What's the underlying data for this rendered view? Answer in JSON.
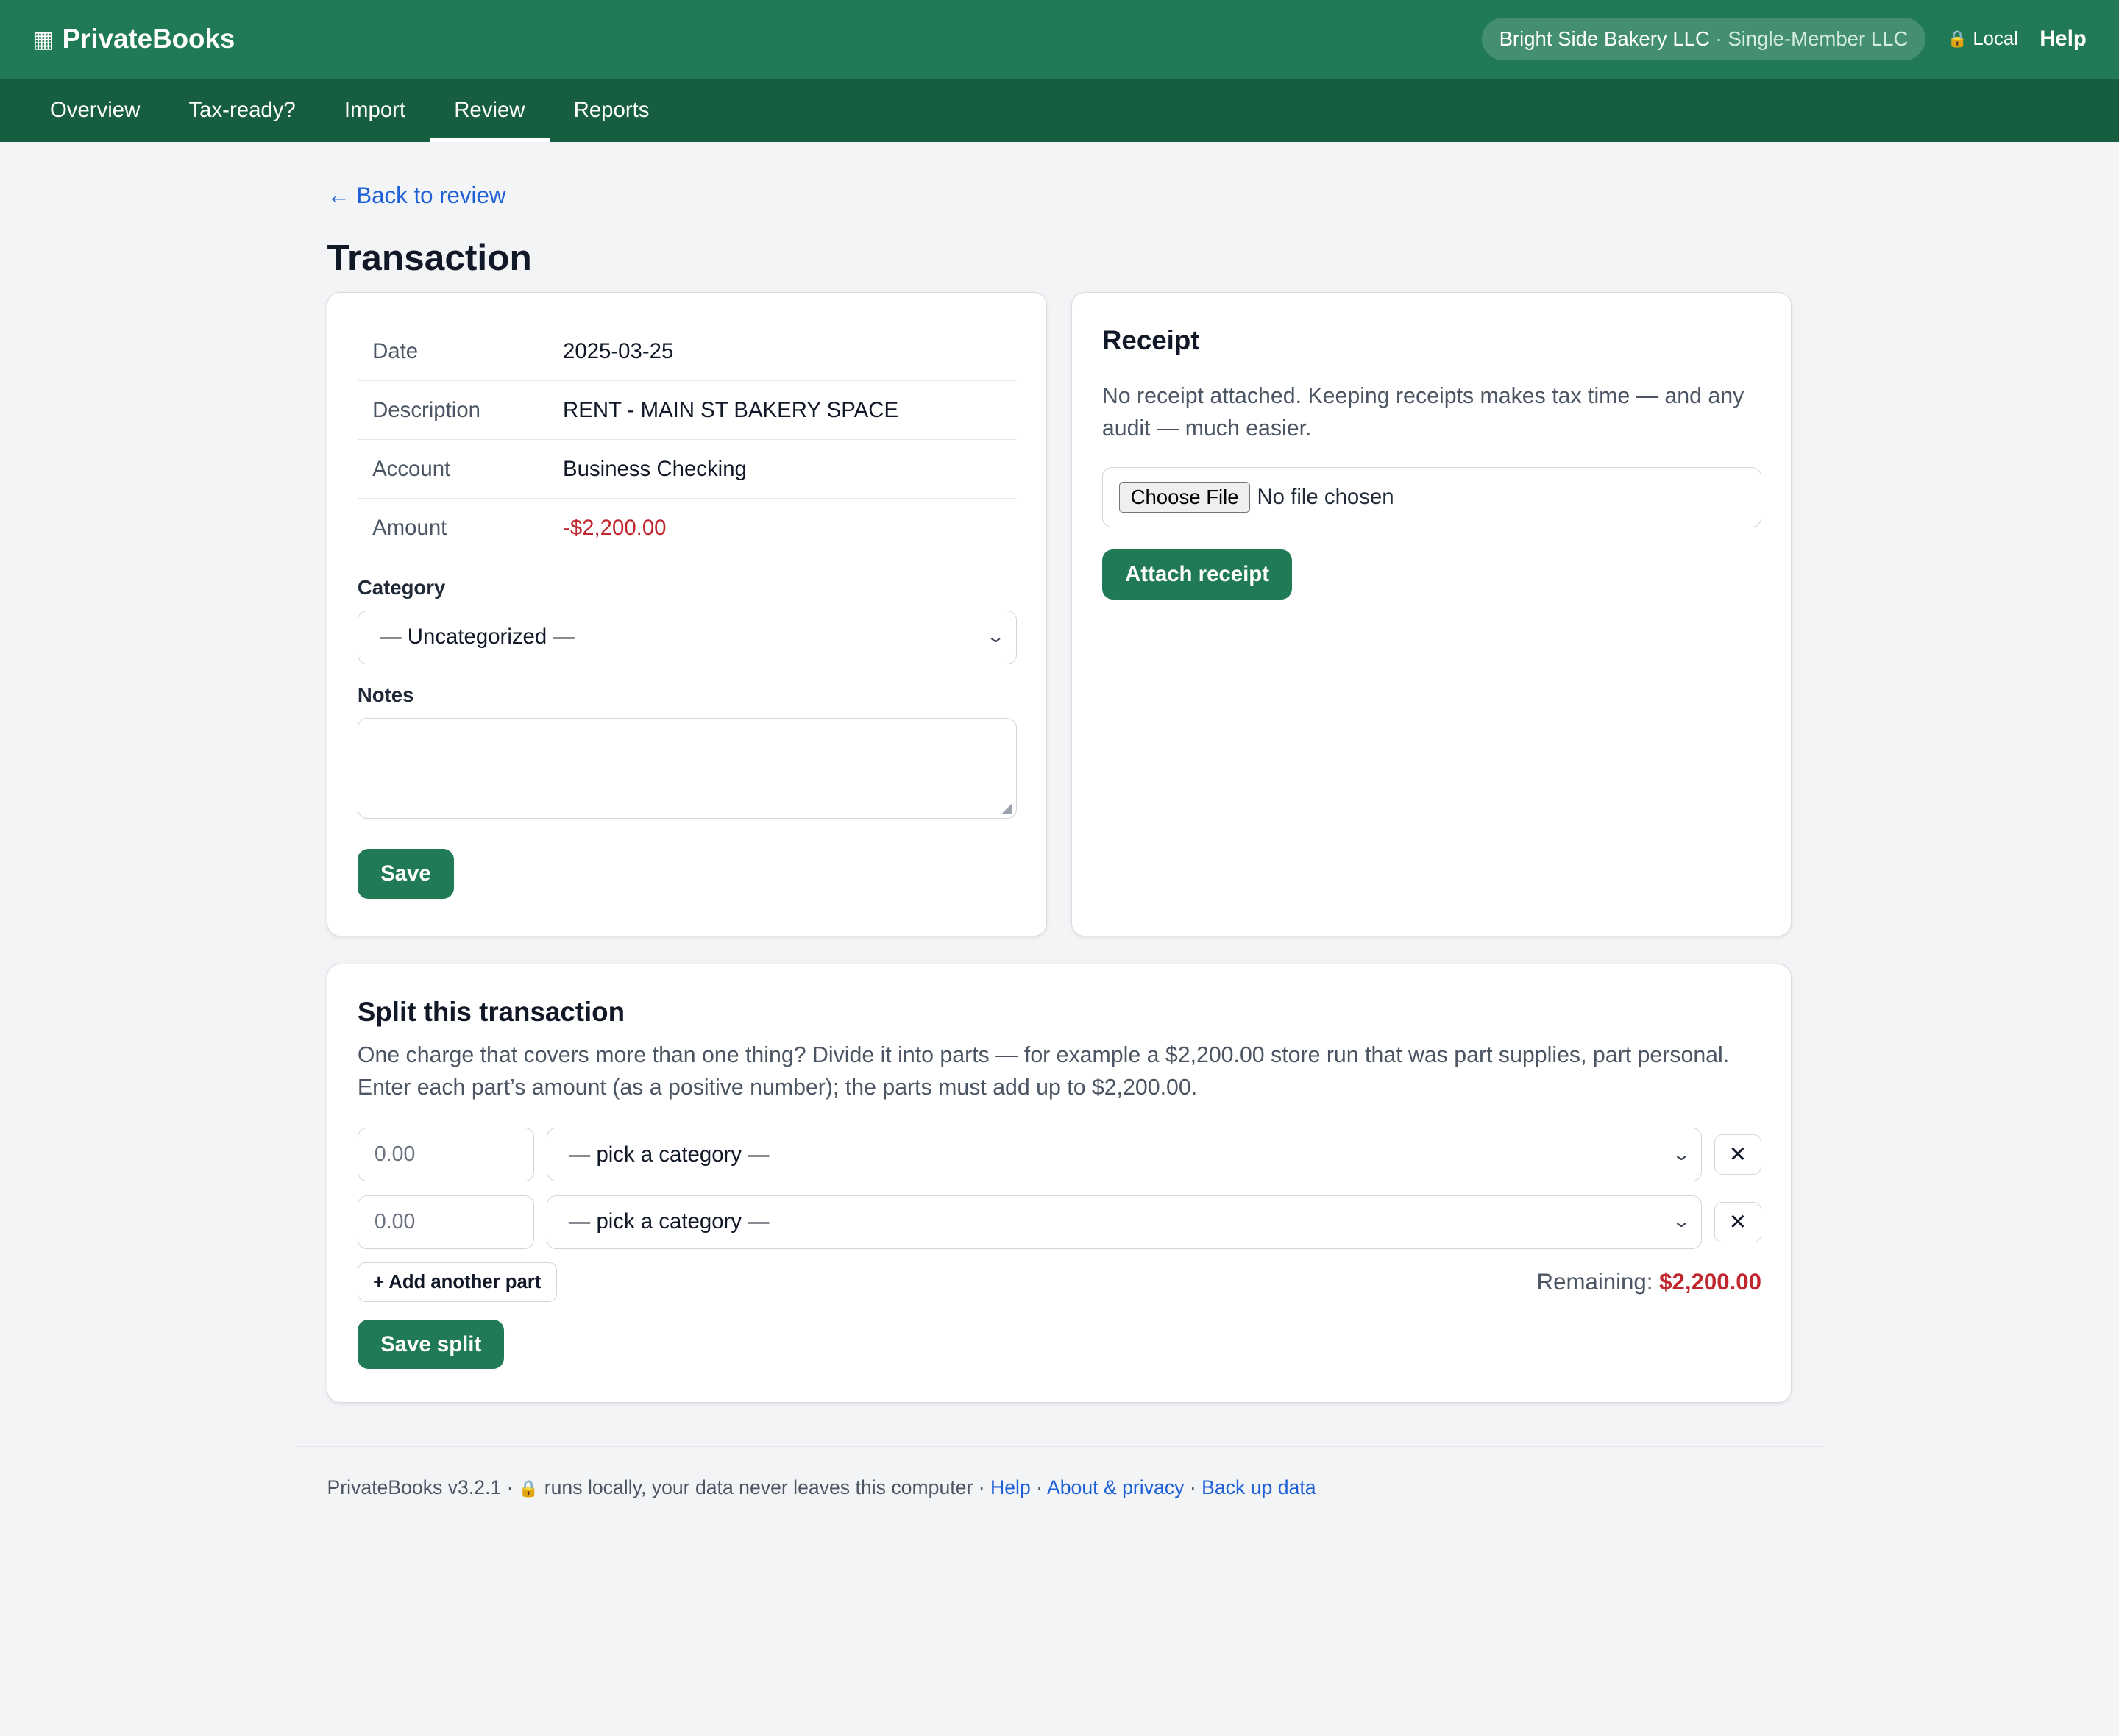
{
  "header": {
    "brand_icon": "▦",
    "brand": "PrivateBooks",
    "business_name": "Bright Side Bakery LLC",
    "business_type": " · Single-Member LLC",
    "lock_icon": "🔒",
    "local_label": "Local",
    "help_label": "Help"
  },
  "nav": {
    "tabs": [
      {
        "label": "Overview",
        "active": false
      },
      {
        "label": "Tax-ready?",
        "active": false
      },
      {
        "label": "Import",
        "active": false
      },
      {
        "label": "Review",
        "active": true
      },
      {
        "label": "Reports",
        "active": false
      }
    ]
  },
  "page": {
    "back_link": "← Back to review",
    "title": "Transaction"
  },
  "details": {
    "date_label": "Date",
    "date_value": "2025-03-25",
    "description_label": "Description",
    "description_value": "RENT - MAIN ST BAKERY SPACE",
    "account_label": "Account",
    "account_value": "Business Checking",
    "amount_label": "Amount",
    "amount_value": "-$2,200.00",
    "category_label": "Category",
    "category_value": "— Uncategorized —",
    "notes_label": "Notes",
    "notes_value": "",
    "save_label": "Save"
  },
  "receipt": {
    "title": "Receipt",
    "message": "No receipt attached. Keeping receipts makes tax time — and any audit — much easier.",
    "choose_file_label": "Choose File",
    "no_file_label": "No file chosen",
    "attach_label": "Attach receipt"
  },
  "split": {
    "title": "Split this transaction",
    "description": "One charge that covers more than one thing? Divide it into parts — for example a $2,200.00 store run that was part supplies, part personal. Enter each part’s amount (as a positive number); the parts must add up to $2,200.00.",
    "parts": [
      {
        "amount_placeholder": "0.00",
        "category": "— pick a category —"
      },
      {
        "amount_placeholder": "0.00",
        "category": "— pick a category —"
      }
    ],
    "remove_glyph": "✕",
    "add_label": "+ Add another part",
    "remaining_label": "Remaining: ",
    "remaining_value": "$2,200.00",
    "save_label": "Save split"
  },
  "footer": {
    "version": "PrivateBooks v3.2.1 · ",
    "lock_icon": "🔒",
    "local_note": " runs locally, your data never leaves this computer · ",
    "help_link": "Help",
    "about_link": "About & privacy",
    "backup_link": "Back up data",
    "sep": " · "
  },
  "colors": {
    "brand_green": "#1f7a55",
    "nav_green": "#175e41",
    "negative_red": "#c0262d",
    "link_blue": "#1d5fd6"
  }
}
